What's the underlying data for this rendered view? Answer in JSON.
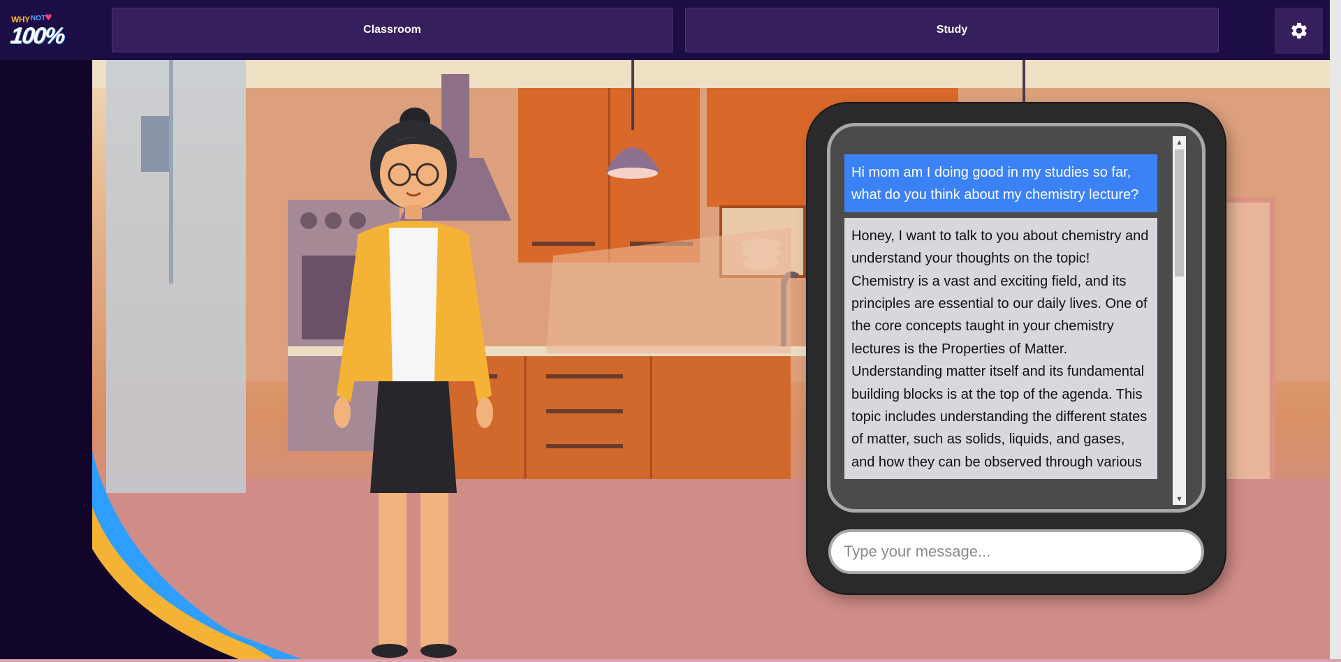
{
  "app": {
    "logo": {
      "line1": "WHY",
      "line2": "NOT",
      "line3": "100%",
      "heart": "♥"
    }
  },
  "nav": {
    "classroom_label": "Classroom",
    "study_label": "Study",
    "settings_icon": "gear-icon"
  },
  "chat": {
    "messages": [
      {
        "role": "user",
        "text": "Hi mom am I doing good in my studies so far, what do you think about my chemistry lecture?"
      },
      {
        "role": "assistant",
        "text": "Honey, I want to talk to you about chemistry and understand your thoughts on the topic! Chemistry is a vast and exciting field, and its principles are essential to our daily lives. One of the core concepts taught in your chemistry lectures is the Properties of Matter. Understanding matter itself and its fundamental building blocks is at the top of the agenda. This topic includes understanding the different states of matter, such as solids, liquids, and gases, and how they can be observed through various"
      }
    ],
    "input_placeholder": "Type your message...",
    "input_value": ""
  },
  "colors": {
    "nav_background": "#1d0d45",
    "nav_button": "#35205d",
    "user_bubble": "#3b82f6",
    "assistant_bubble": "#d6d8de",
    "chat_frame": "#2a2a2a"
  }
}
